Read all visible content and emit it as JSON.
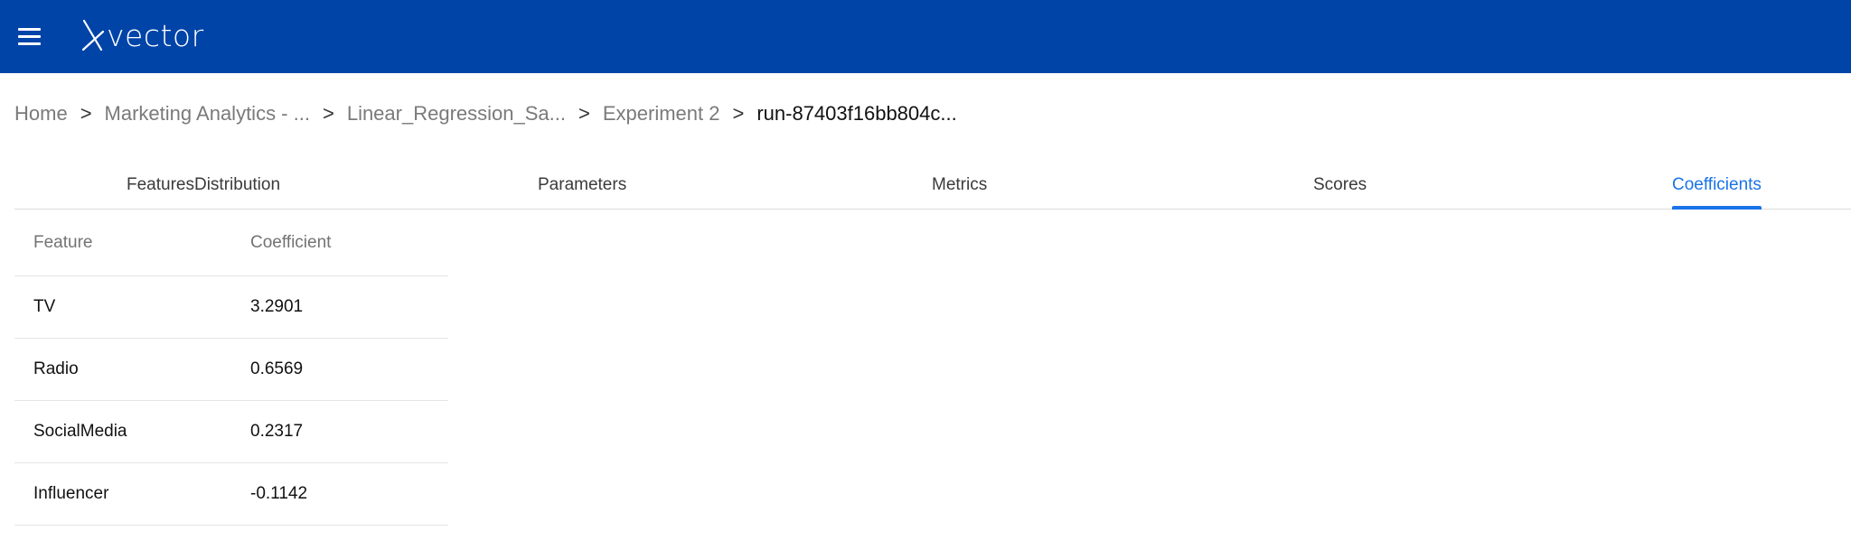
{
  "header": {
    "logo_text": "vector",
    "bg_color": "#0044a8"
  },
  "breadcrumb": {
    "items": [
      "Home",
      "Marketing Analytics - ...",
      "Linear_Regression_Sa...",
      "Experiment 2",
      "run-87403f16bb804c..."
    ],
    "separator": ">"
  },
  "tabs": [
    {
      "label": "FeaturesDistribution",
      "active": false
    },
    {
      "label": "Parameters",
      "active": false
    },
    {
      "label": "Metrics",
      "active": false
    },
    {
      "label": "Scores",
      "active": false
    },
    {
      "label": "Coefficients",
      "active": true
    }
  ],
  "accent_color": "#1a73e8",
  "coefficients_table": {
    "columns": [
      "Feature",
      "Coefficient"
    ],
    "rows": [
      {
        "feature": "TV",
        "coefficient": "3.2901"
      },
      {
        "feature": "Radio",
        "coefficient": "0.6569"
      },
      {
        "feature": "SocialMedia",
        "coefficient": "0.2317"
      },
      {
        "feature": "Influencer",
        "coefficient": "-0.1142"
      }
    ]
  }
}
